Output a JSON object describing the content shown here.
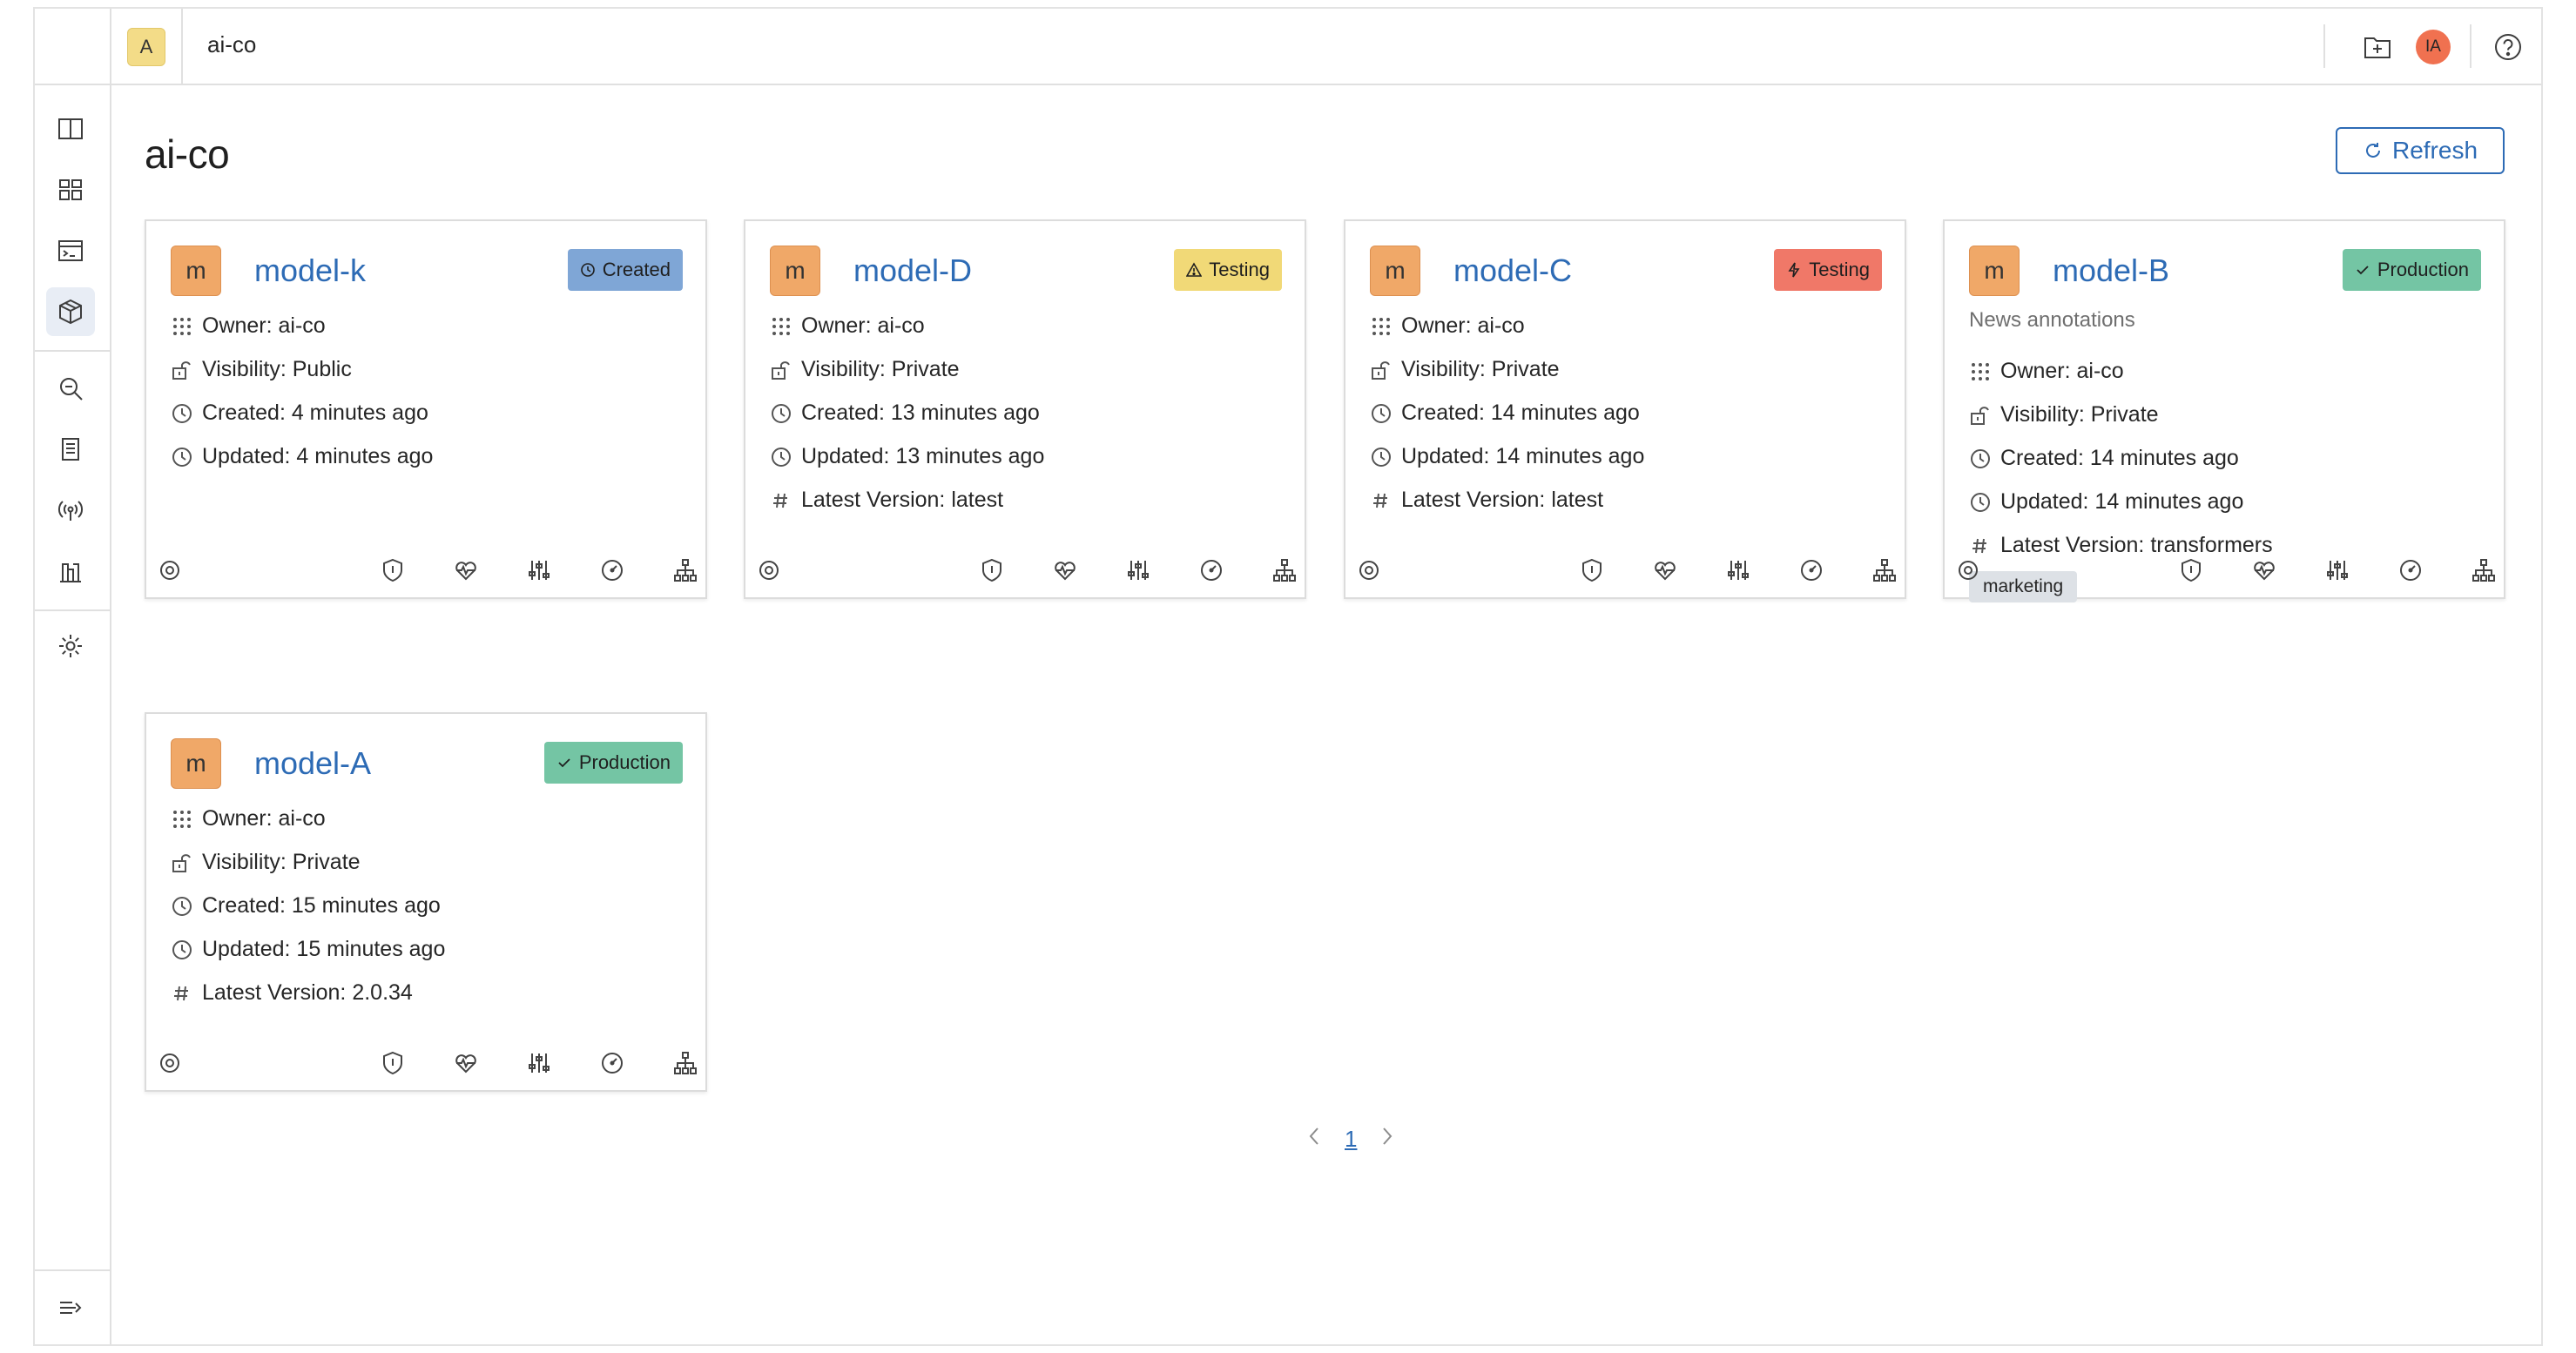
{
  "workspace": {
    "badge": "A",
    "name": "ai-co"
  },
  "user": {
    "initials": "IA"
  },
  "page": {
    "title": "ai-co",
    "refresh_label": "Refresh"
  },
  "colors": {
    "accent": "#2d6bb5",
    "model_avatar": "#f0a868",
    "created": "#7fa6d6",
    "testing_warn": "#f1d977",
    "testing_danger": "#f07868",
    "production": "#74c5a4"
  },
  "sidebar": {
    "items": [
      {
        "name": "sidebar-toggle",
        "icon": "panel-icon"
      },
      {
        "name": "dashboard",
        "icon": "grid-icon"
      },
      {
        "name": "terminal",
        "icon": "terminal-icon"
      },
      {
        "name": "models",
        "icon": "cube-icon",
        "active": true
      },
      {
        "name": "search",
        "icon": "search-icon"
      },
      {
        "name": "documents",
        "icon": "document-icon"
      },
      {
        "name": "broadcast",
        "icon": "broadcast-icon"
      },
      {
        "name": "datasets",
        "icon": "chart-icon"
      },
      {
        "name": "settings",
        "icon": "gear-icon"
      },
      {
        "name": "expand",
        "icon": "expand-icon"
      }
    ]
  },
  "models": [
    {
      "avatar": "m",
      "name": "model-k",
      "status": "Created",
      "status_icon": "clock-icon",
      "owner": "Owner: ai-co",
      "visibility": "Visibility: Public",
      "created": "Created: 4 minutes ago",
      "updated": "Updated: 4 minutes ago"
    },
    {
      "avatar": "m",
      "name": "model-D",
      "status": "Testing",
      "status_icon": "warning-icon",
      "owner": "Owner: ai-co",
      "visibility": "Visibility: Private",
      "created": "Created: 13 minutes ago",
      "updated": "Updated: 13 minutes ago",
      "version": "Latest Version: latest"
    },
    {
      "avatar": "m",
      "name": "model-C",
      "status": "Testing",
      "status_icon": "lightning-icon",
      "owner": "Owner: ai-co",
      "visibility": "Visibility: Private",
      "created": "Created: 14 minutes ago",
      "updated": "Updated: 14 minutes ago",
      "version": "Latest Version: latest"
    },
    {
      "avatar": "m",
      "name": "model-B",
      "status": "Production",
      "status_icon": "check-icon",
      "description": "News annotations",
      "owner": "Owner: ai-co",
      "visibility": "Visibility: Private",
      "created": "Created: 14 minutes ago",
      "updated": "Updated: 14 minutes ago",
      "version": "Latest Version: transformers",
      "tag": "marketing"
    },
    {
      "avatar": "m",
      "name": "model-A",
      "status": "Production",
      "status_icon": "check-icon",
      "owner": "Owner: ai-co",
      "visibility": "Visibility: Private",
      "created": "Created: 15 minutes ago",
      "updated": "Updated: 15 minutes ago",
      "version": "Latest Version: 2.0.34"
    }
  ],
  "card_actions": [
    "gear-icon",
    "shield-icon",
    "heartbeat-icon",
    "sliders-icon",
    "gauge-icon",
    "hierarchy-icon"
  ],
  "pagination": {
    "current": "1"
  }
}
